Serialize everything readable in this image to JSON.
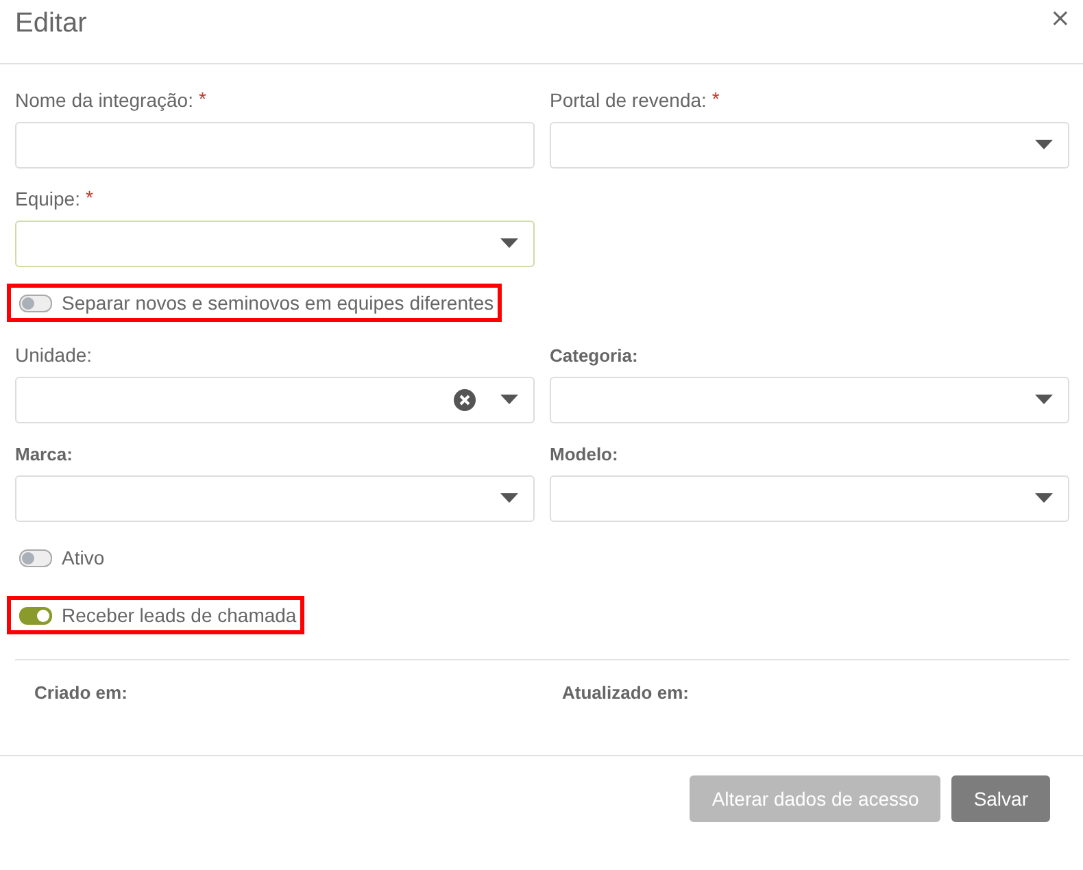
{
  "dialog": {
    "title": "Editar",
    "close": "×"
  },
  "sections": [
    {
      "kind": "fields",
      "fields": [
        {
          "label": "Nome da integração:",
          "required_mark": "*",
          "kind": "text",
          "strong": false,
          "focused": false
        },
        {
          "label": "Portal de revenda:",
          "required_mark": "*",
          "kind": "select",
          "strong": false,
          "focused": false,
          "clearable": false
        }
      ]
    },
    {
      "kind": "fields",
      "fields": [
        {
          "label": "Equipe:",
          "required_mark": "*",
          "kind": "select",
          "strong": false,
          "focused": true,
          "clearable": false
        }
      ]
    },
    {
      "kind": "toggle",
      "label": "Separar novos e seminovos em equipes diferentes",
      "on": false,
      "highlighted": true
    },
    {
      "kind": "fields",
      "fields": [
        {
          "label": "Unidade:",
          "kind": "select",
          "strong": false,
          "focused": false,
          "clearable": true
        },
        {
          "label": "Categoria:",
          "kind": "select",
          "strong": true,
          "focused": false,
          "clearable": false
        }
      ]
    },
    {
      "kind": "fields",
      "fields": [
        {
          "label": "Marca:",
          "kind": "select",
          "strong": true,
          "focused": false,
          "clearable": false
        },
        {
          "label": "Modelo:",
          "kind": "select",
          "strong": true,
          "focused": false,
          "clearable": false
        }
      ]
    },
    {
      "kind": "toggle",
      "label": "Ativo",
      "on": false
    },
    {
      "kind": "toggle",
      "label": "Receber leads de chamada",
      "on": true,
      "highlighted": true
    }
  ],
  "info": [
    "Criado em:",
    "Atualizado em:"
  ],
  "buttons": [
    {
      "label": "Alterar dados de acesso",
      "disabled": true
    },
    {
      "label": "Salvar",
      "disabled": false
    }
  ]
}
